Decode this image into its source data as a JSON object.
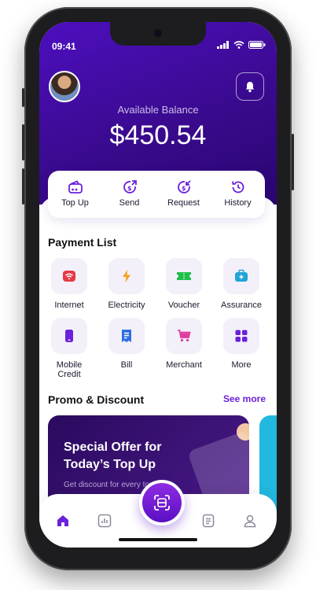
{
  "status_bar": {
    "time": "09:41"
  },
  "balance": {
    "label": "Available Balance",
    "value": "$450.54"
  },
  "quick_actions": [
    {
      "label": "Top Up",
      "icon": "wallet-icon"
    },
    {
      "label": "Send",
      "icon": "send-money-icon"
    },
    {
      "label": "Request",
      "icon": "request-money-icon"
    },
    {
      "label": "History",
      "icon": "history-icon"
    }
  ],
  "payment_list": {
    "title": "Payment List",
    "items": [
      {
        "label": "Internet",
        "icon": "wifi-icon",
        "color": "#e63946"
      },
      {
        "label": "Electricity",
        "icon": "lightning-icon",
        "color": "#f4a21c"
      },
      {
        "label": "Voucher",
        "icon": "ticket-icon",
        "color": "#1fbf4b"
      },
      {
        "label": "Assurance",
        "icon": "medical-kit-icon",
        "color": "#22a5d6"
      },
      {
        "label": "Mobile\nCredit",
        "icon": "phone-icon",
        "color": "#6b21d9"
      },
      {
        "label": "Bill",
        "icon": "bill-icon",
        "color": "#2f6fe0"
      },
      {
        "label": "Merchant",
        "icon": "cart-icon",
        "color": "#e03ca0"
      },
      {
        "label": "More",
        "icon": "grid-icon",
        "color": "#6b21d9"
      }
    ]
  },
  "promo": {
    "title": "Promo & Discount",
    "see_more": "See more",
    "card_title": "Special Offer for Today’s Top Up",
    "card_subtitle": "Get discount for every top up"
  },
  "colors": {
    "primary": "#4d0fbf",
    "accent": "#6b21d9"
  }
}
